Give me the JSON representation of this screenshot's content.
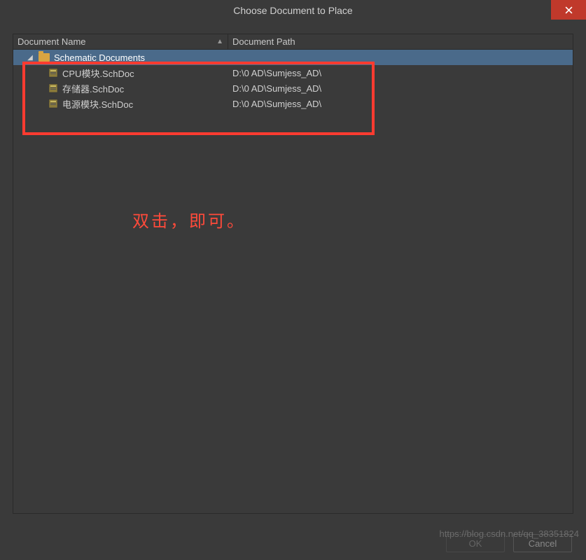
{
  "dialog": {
    "title": "Choose Document to Place"
  },
  "columns": {
    "name": "Document Name",
    "path": "Document Path"
  },
  "tree": {
    "root": {
      "label": "Schematic Documents"
    },
    "files": [
      {
        "name": "CPU模块.SchDoc",
        "path": "D:\\0 AD\\Sumjess_AD\\"
      },
      {
        "name": "存储器.SchDoc",
        "path": "D:\\0 AD\\Sumjess_AD\\"
      },
      {
        "name": "电源模块.SchDoc",
        "path": "D:\\0 AD\\Sumjess_AD\\"
      }
    ]
  },
  "annotation": "双击，即可。",
  "buttons": {
    "ok": "OK",
    "cancel": "Cancel"
  },
  "watermark": "https://blog.csdn.net/qq_38351824"
}
